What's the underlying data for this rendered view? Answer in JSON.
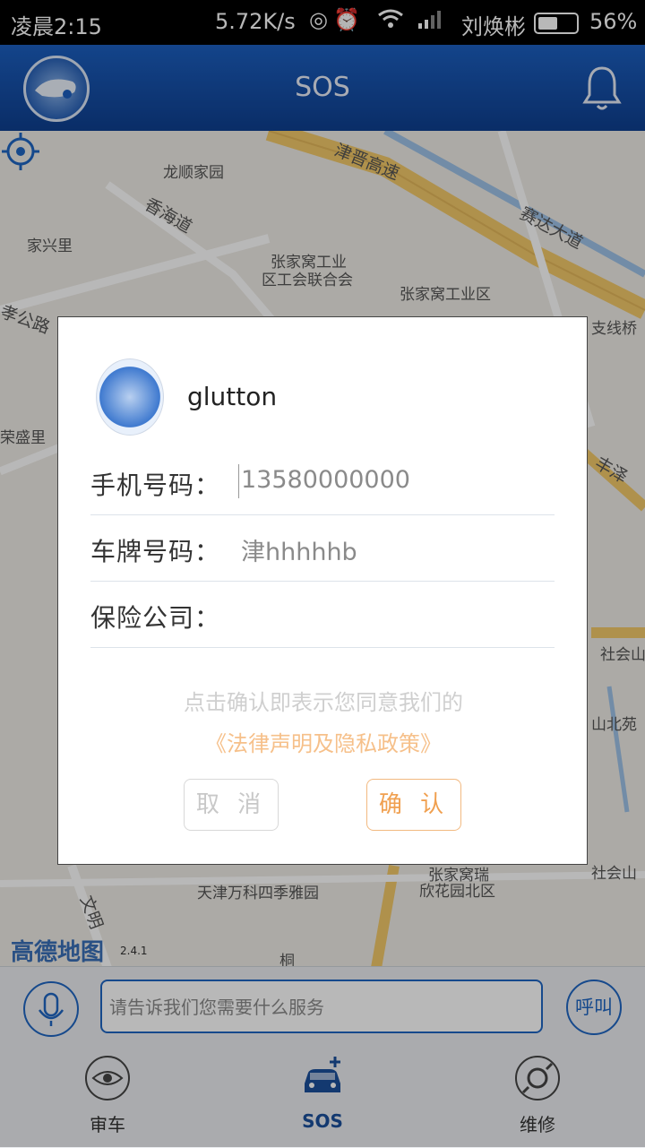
{
  "status_bar": {
    "time": "凌晨2:15",
    "net_speed": "5.72K/s",
    "carrier": "刘焕彬",
    "battery": "56%",
    "battery_level": 0.56
  },
  "app_bar": {
    "title": "SOS"
  },
  "map": {
    "labels": [
      "龙顺家园",
      "香海道",
      "家兴里",
      "张家窝工业",
      "区工会联合会",
      "张家窝工业区",
      "津晋高速",
      "赛达大道",
      "荣盛里",
      "孝公路",
      "支线桥",
      "丰泽",
      "社会山",
      "山北苑",
      "社会山",
      "张家窝瑞",
      "欣花园北区",
      "天津万科四季雅园",
      "文明",
      "桐"
    ],
    "brand": "高德地图",
    "version": "2.4.1"
  },
  "dialog": {
    "username": "glutton",
    "fields": [
      {
        "label": "手机号码：",
        "value": "13580000000"
      },
      {
        "label": "车牌号码：",
        "value": "津hhhhhb"
      },
      {
        "label": "保险公司：",
        "value": ""
      }
    ],
    "consent_text": "点击确认即表示您同意我们的",
    "consent_link": "《法律声明及隐私政策》",
    "cancel": "取 消",
    "confirm": "确 认"
  },
  "bottom": {
    "input_placeholder": "请告诉我们您需要什么服务",
    "call_button": "呼叫",
    "tabs": [
      {
        "label": "审车",
        "icon": "eye-icon"
      },
      {
        "label": "SOS",
        "icon": "car-plus-icon",
        "active": true
      },
      {
        "label": "维修",
        "icon": "wrench-icon"
      }
    ]
  },
  "colors": {
    "primary": "#1f66c2",
    "accent": "#f0a050",
    "appbar": "#1c5fc0"
  }
}
